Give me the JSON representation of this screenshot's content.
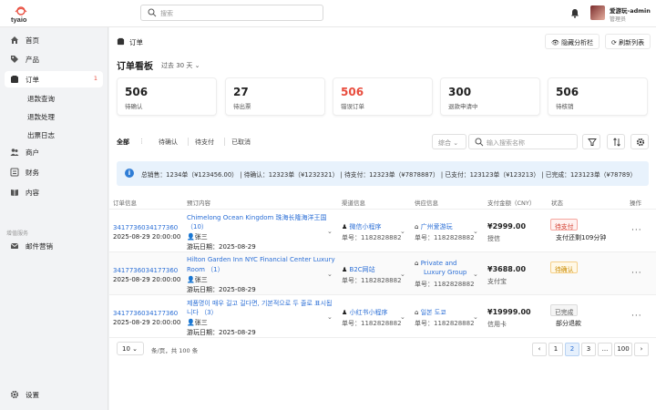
{
  "brand": {
    "logo_text": "tyaio",
    "accent": "#e84c3d",
    "link": "#2a6ed6"
  },
  "topbar": {
    "search_placeholder": "搜索",
    "user_name": "爱游玩-admin",
    "user_role": "管理员"
  },
  "sidebar": {
    "items": [
      {
        "label": "首页",
        "icon": "home-icon"
      },
      {
        "label": "产品",
        "icon": "tag-icon"
      },
      {
        "label": "订单",
        "icon": "order-icon",
        "badge": "1"
      },
      {
        "label": "商户",
        "icon": "users-icon"
      },
      {
        "label": "财务",
        "icon": "finance-icon"
      },
      {
        "label": "内容",
        "icon": "book-icon"
      }
    ],
    "sub_items": [
      "退款查询",
      "退款处理",
      "出票日志"
    ],
    "section": "增值服务",
    "extra_item": "邮件营销",
    "settings": "设置"
  },
  "page": {
    "breadcrumb": "订单",
    "hide_analysis": "隐藏分析栏",
    "refresh": "刷新列表",
    "board_title": "订单看板",
    "range": "过去 30 天"
  },
  "cards": [
    {
      "value": "506",
      "label": "待确认"
    },
    {
      "value": "27",
      "label": "待出票"
    },
    {
      "value": "506",
      "label": "错误订单"
    },
    {
      "value": "300",
      "label": "退款申请中"
    },
    {
      "value": "506",
      "label": "待核销"
    }
  ],
  "tabs": [
    "全部",
    "待确认",
    "待支付",
    "已取消"
  ],
  "filter": {
    "compound": "综合",
    "search_placeholder": "输入搜索名称"
  },
  "summary": "总销售：1234单（¥123456.00） | 待确认：12323单（¥1232321） | 待支付：12323单（¥7878887） | 已支付：123123单（¥123213） | 已完成：123123单（¥78789）",
  "columns": [
    "订单信息",
    "预订内容",
    "渠道信息",
    "供应信息",
    "支付金额（CNY）",
    "状态",
    "操作"
  ],
  "rows": [
    {
      "order_no": "3417736034177360",
      "time": "2025-08-29 20:00:00",
      "product": "Chimelong Ocean Kingdom 珠海长隆海洋王国",
      "qty": "（10）",
      "guest": "张三",
      "visit": "游玩日期：2025-08-29",
      "channel": "微信小程序",
      "channel_no": "单号：1182828882",
      "supplier": "广州爱游玩",
      "supplier_no": "单号：1182828882",
      "amount": "¥2999.00",
      "pay": "授信",
      "status": "待支付",
      "status_note": "支付还剩109分钟"
    },
    {
      "order_no": "3417736034177360",
      "time": "2025-08-29 20:00:00",
      "product": "Hilton Garden Inn NYC Financial Center Luxury",
      "product2": "Room （1）",
      "guest": "张三",
      "visit": "游玩日期：2025-08-29",
      "channel": "B2C网站",
      "channel_no": "单号：1182828882",
      "supplier": "Private and",
      "supplier2": "Luxury Group",
      "supplier_no": "单号：1182828882",
      "amount": "¥3688.00",
      "pay": "支付宝",
      "status": "待确认",
      "status_note": ""
    },
    {
      "order_no": "3417736034177360",
      "time": "2025-08-29 20:00:00",
      "product": "제품명이 매우 길고 길다면, 기본적으로 두 줄로 표시됩",
      "product2": "니다 （3）",
      "guest": "张三",
      "visit": "游玩日期：2025-08-29",
      "channel": "小红书小程序",
      "channel_no": "单号：1182828882",
      "supplier": "일본 도쿄",
      "supplier_no": "单号：1182828882",
      "amount": "¥19999.00",
      "pay": "信用卡",
      "status": "已完成",
      "status_note": "部分退款"
    }
  ],
  "pagination": {
    "size": "10",
    "summary": "条/页，共 100 条",
    "pages": [
      "1",
      "2",
      "3",
      "...",
      "100"
    ],
    "current": "2"
  }
}
